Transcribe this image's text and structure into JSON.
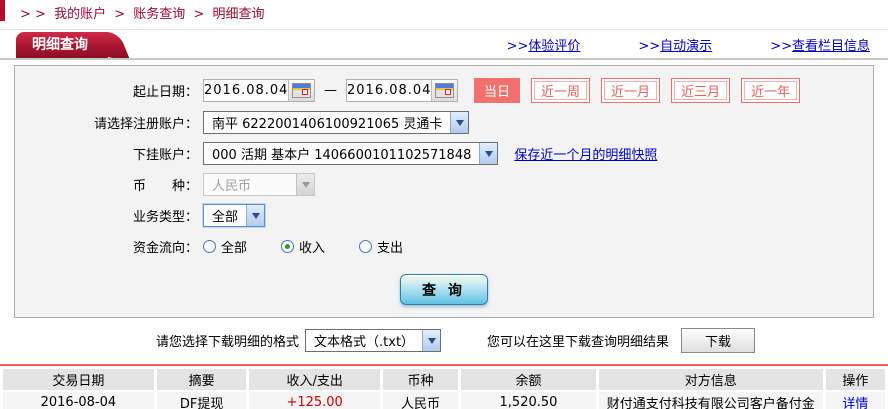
{
  "breadcrumb": {
    "prefix": "> >",
    "separator": ">",
    "items": [
      "我的账户",
      "账务查询",
      "明细查询"
    ]
  },
  "tab": {
    "title": "明细查询"
  },
  "top_links": [
    {
      "prefix": ">>",
      "label": "体验评价"
    },
    {
      "prefix": ">>",
      "label": "自动演示"
    },
    {
      "prefix": ">>",
      "label": "查看栏目信息"
    }
  ],
  "form": {
    "date_label": "起止日期：",
    "date_from": "2016.08.04",
    "date_to": "2016.08.04",
    "date_separator": "—",
    "period_buttons": [
      {
        "label": "当日",
        "active": true
      },
      {
        "label": "近一周",
        "active": false
      },
      {
        "label": "近一月",
        "active": false
      },
      {
        "label": "近三月",
        "active": false
      },
      {
        "label": "近一年",
        "active": false
      }
    ],
    "register_account": {
      "label": "请选择注册账户：",
      "value": "南平  6222001406100921065 灵通卡"
    },
    "sub_account": {
      "label": "下挂账户：",
      "value": "000 活期 基本户 1406600101102571848",
      "link": "保存近一个月的明细快照"
    },
    "currency": {
      "label": "币　　种：",
      "value": "人民币",
      "disabled": true
    },
    "biz_type": {
      "label": "业务类型：",
      "value": "全部"
    },
    "flow": {
      "label": "资金流向：",
      "options": [
        {
          "label": "全部",
          "checked": false
        },
        {
          "label": "收入",
          "checked": true
        },
        {
          "label": "支出",
          "checked": false
        }
      ]
    },
    "query_button": "查 询"
  },
  "download": {
    "format_label": "请您选择下载明细的格式",
    "format_value": "文本格式（.txt）",
    "hint": "您可以在这里下载查询明细结果",
    "button": "下载"
  },
  "table": {
    "headers": [
      "交易日期",
      "摘要",
      "收入/支出",
      "币种",
      "余额",
      "对方信息",
      "操作"
    ],
    "rows": [
      {
        "date": "2016-08-04",
        "summary": "DF提现",
        "amount": "+125.00",
        "currency": "人民币",
        "balance": "1,520.50",
        "counterparty": "财付通支付科技有限公司客户备付金",
        "action": "详情"
      }
    ]
  },
  "colors": {
    "brand_dark_red": "#a91530",
    "accent_coral": "#f0716d",
    "link_blue": "#0000cc",
    "amount_red": "#cc0000",
    "table_rule_red": "#f25c5a"
  }
}
